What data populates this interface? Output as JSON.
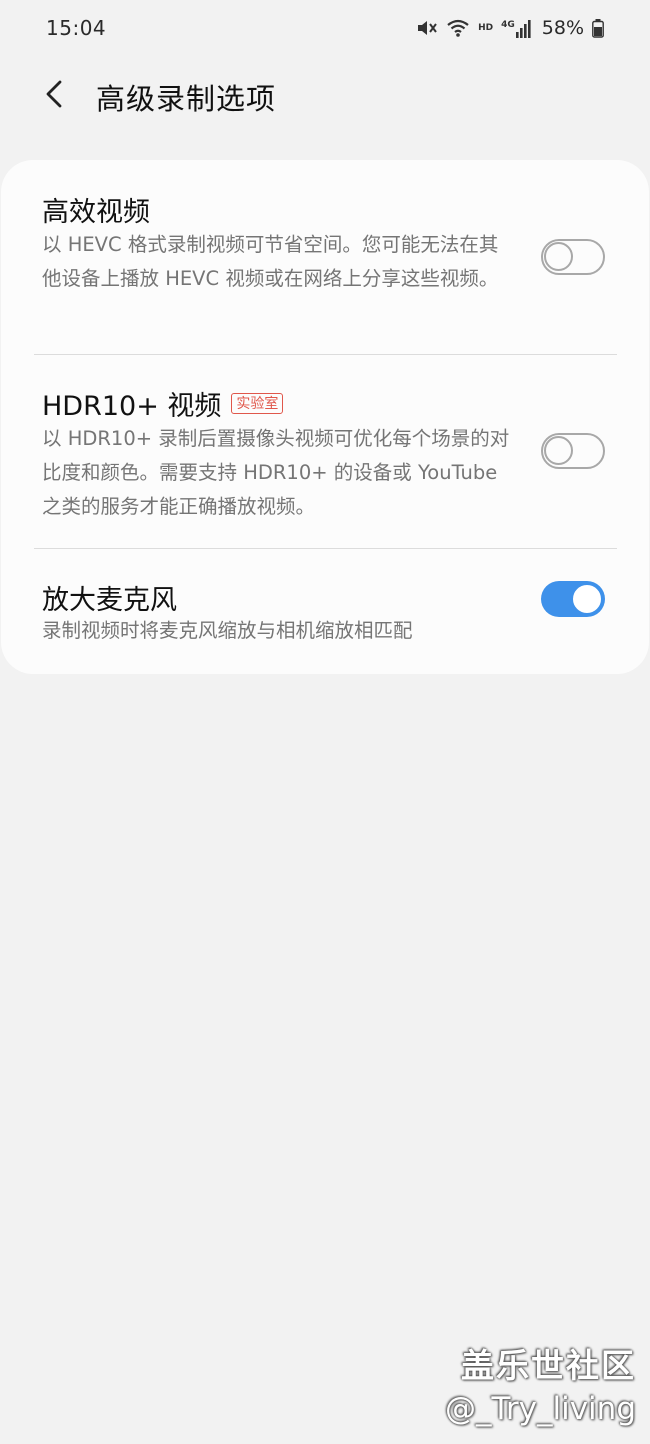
{
  "status_bar": {
    "time": "15:04",
    "hd": "HD",
    "network": "4G",
    "battery": "58%",
    "icons": [
      "mute-icon",
      "wifi-icon",
      "signal-icon",
      "battery-icon"
    ]
  },
  "header": {
    "back_icon": "chevron-left-icon",
    "title": "高级录制选项"
  },
  "settings": [
    {
      "title": "高效视频",
      "badge": "",
      "description": "以 HEVC 格式录制视频可节省空间。您可能无法在其他设备上播放 HEVC 视频或在网络上分享这些视频。",
      "enabled": false
    },
    {
      "title": "HDR10+ 视频",
      "badge": "实验室",
      "description": "以 HDR10+ 录制后置摄像头视频可优化每个场景的对比度和颜色。需要支持 HDR10+ 的设备或 YouTube 之类的服务才能正确播放视频。",
      "enabled": false
    },
    {
      "title": "放大麦克风",
      "badge": "",
      "description": "录制视频时将麦克风缩放与相机缩放相匹配",
      "enabled": true
    }
  ],
  "watermark": {
    "line1": "盖乐世社区",
    "line2": "@_Try_living"
  },
  "colors": {
    "accent": "#3e91ea",
    "badge": "#e0574b",
    "background": "#f2f2f2",
    "card": "#fcfcfc"
  }
}
